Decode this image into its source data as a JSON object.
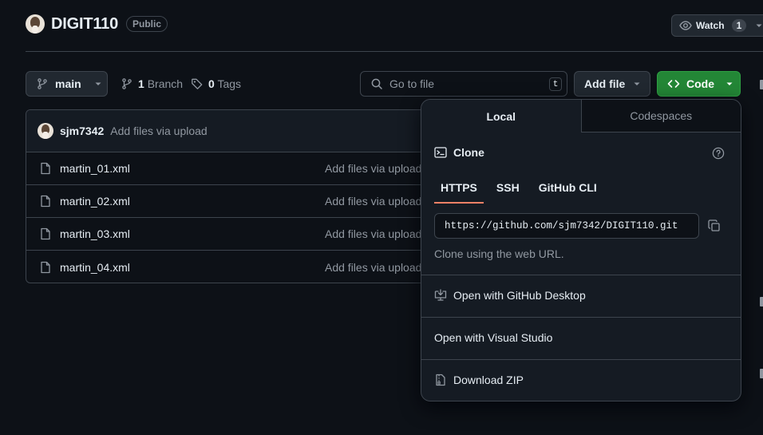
{
  "repo": {
    "name": "DIGIT110",
    "visibility": "Public",
    "watch_label": "Watch",
    "watch_count": "1"
  },
  "toolbar": {
    "branch": "main",
    "branches_count": "1",
    "branches_label": "Branch",
    "tags_count": "0",
    "tags_label": "Tags",
    "goto_placeholder": "Go to file",
    "goto_shortcut": "t",
    "add_file_label": "Add file",
    "code_label": "Code"
  },
  "latest_commit": {
    "author": "sjm7342",
    "message": "Add files via upload"
  },
  "files": [
    {
      "name": "martin_01.xml",
      "commit": "Add files via upload"
    },
    {
      "name": "martin_02.xml",
      "commit": "Add files via upload"
    },
    {
      "name": "martin_03.xml",
      "commit": "Add files via upload"
    },
    {
      "name": "martin_04.xml",
      "commit": "Add files via upload"
    }
  ],
  "code_dropdown": {
    "tabs": [
      "Local",
      "Codespaces"
    ],
    "clone_title": "Clone",
    "protocols": [
      "HTTPS",
      "SSH",
      "GitHub CLI"
    ],
    "url": "https://github.com/sjm7342/DIGIT110.git",
    "hint": "Clone using the web URL.",
    "open_desktop": "Open with GitHub Desktop",
    "open_vs": "Open with Visual Studio",
    "download_zip": "Download ZIP"
  },
  "colors": {
    "background": "#0d1117",
    "border": "#3d444d",
    "accent_green": "#238636",
    "active_tab_underline": "#f78166",
    "muted_text": "#9198a1"
  }
}
